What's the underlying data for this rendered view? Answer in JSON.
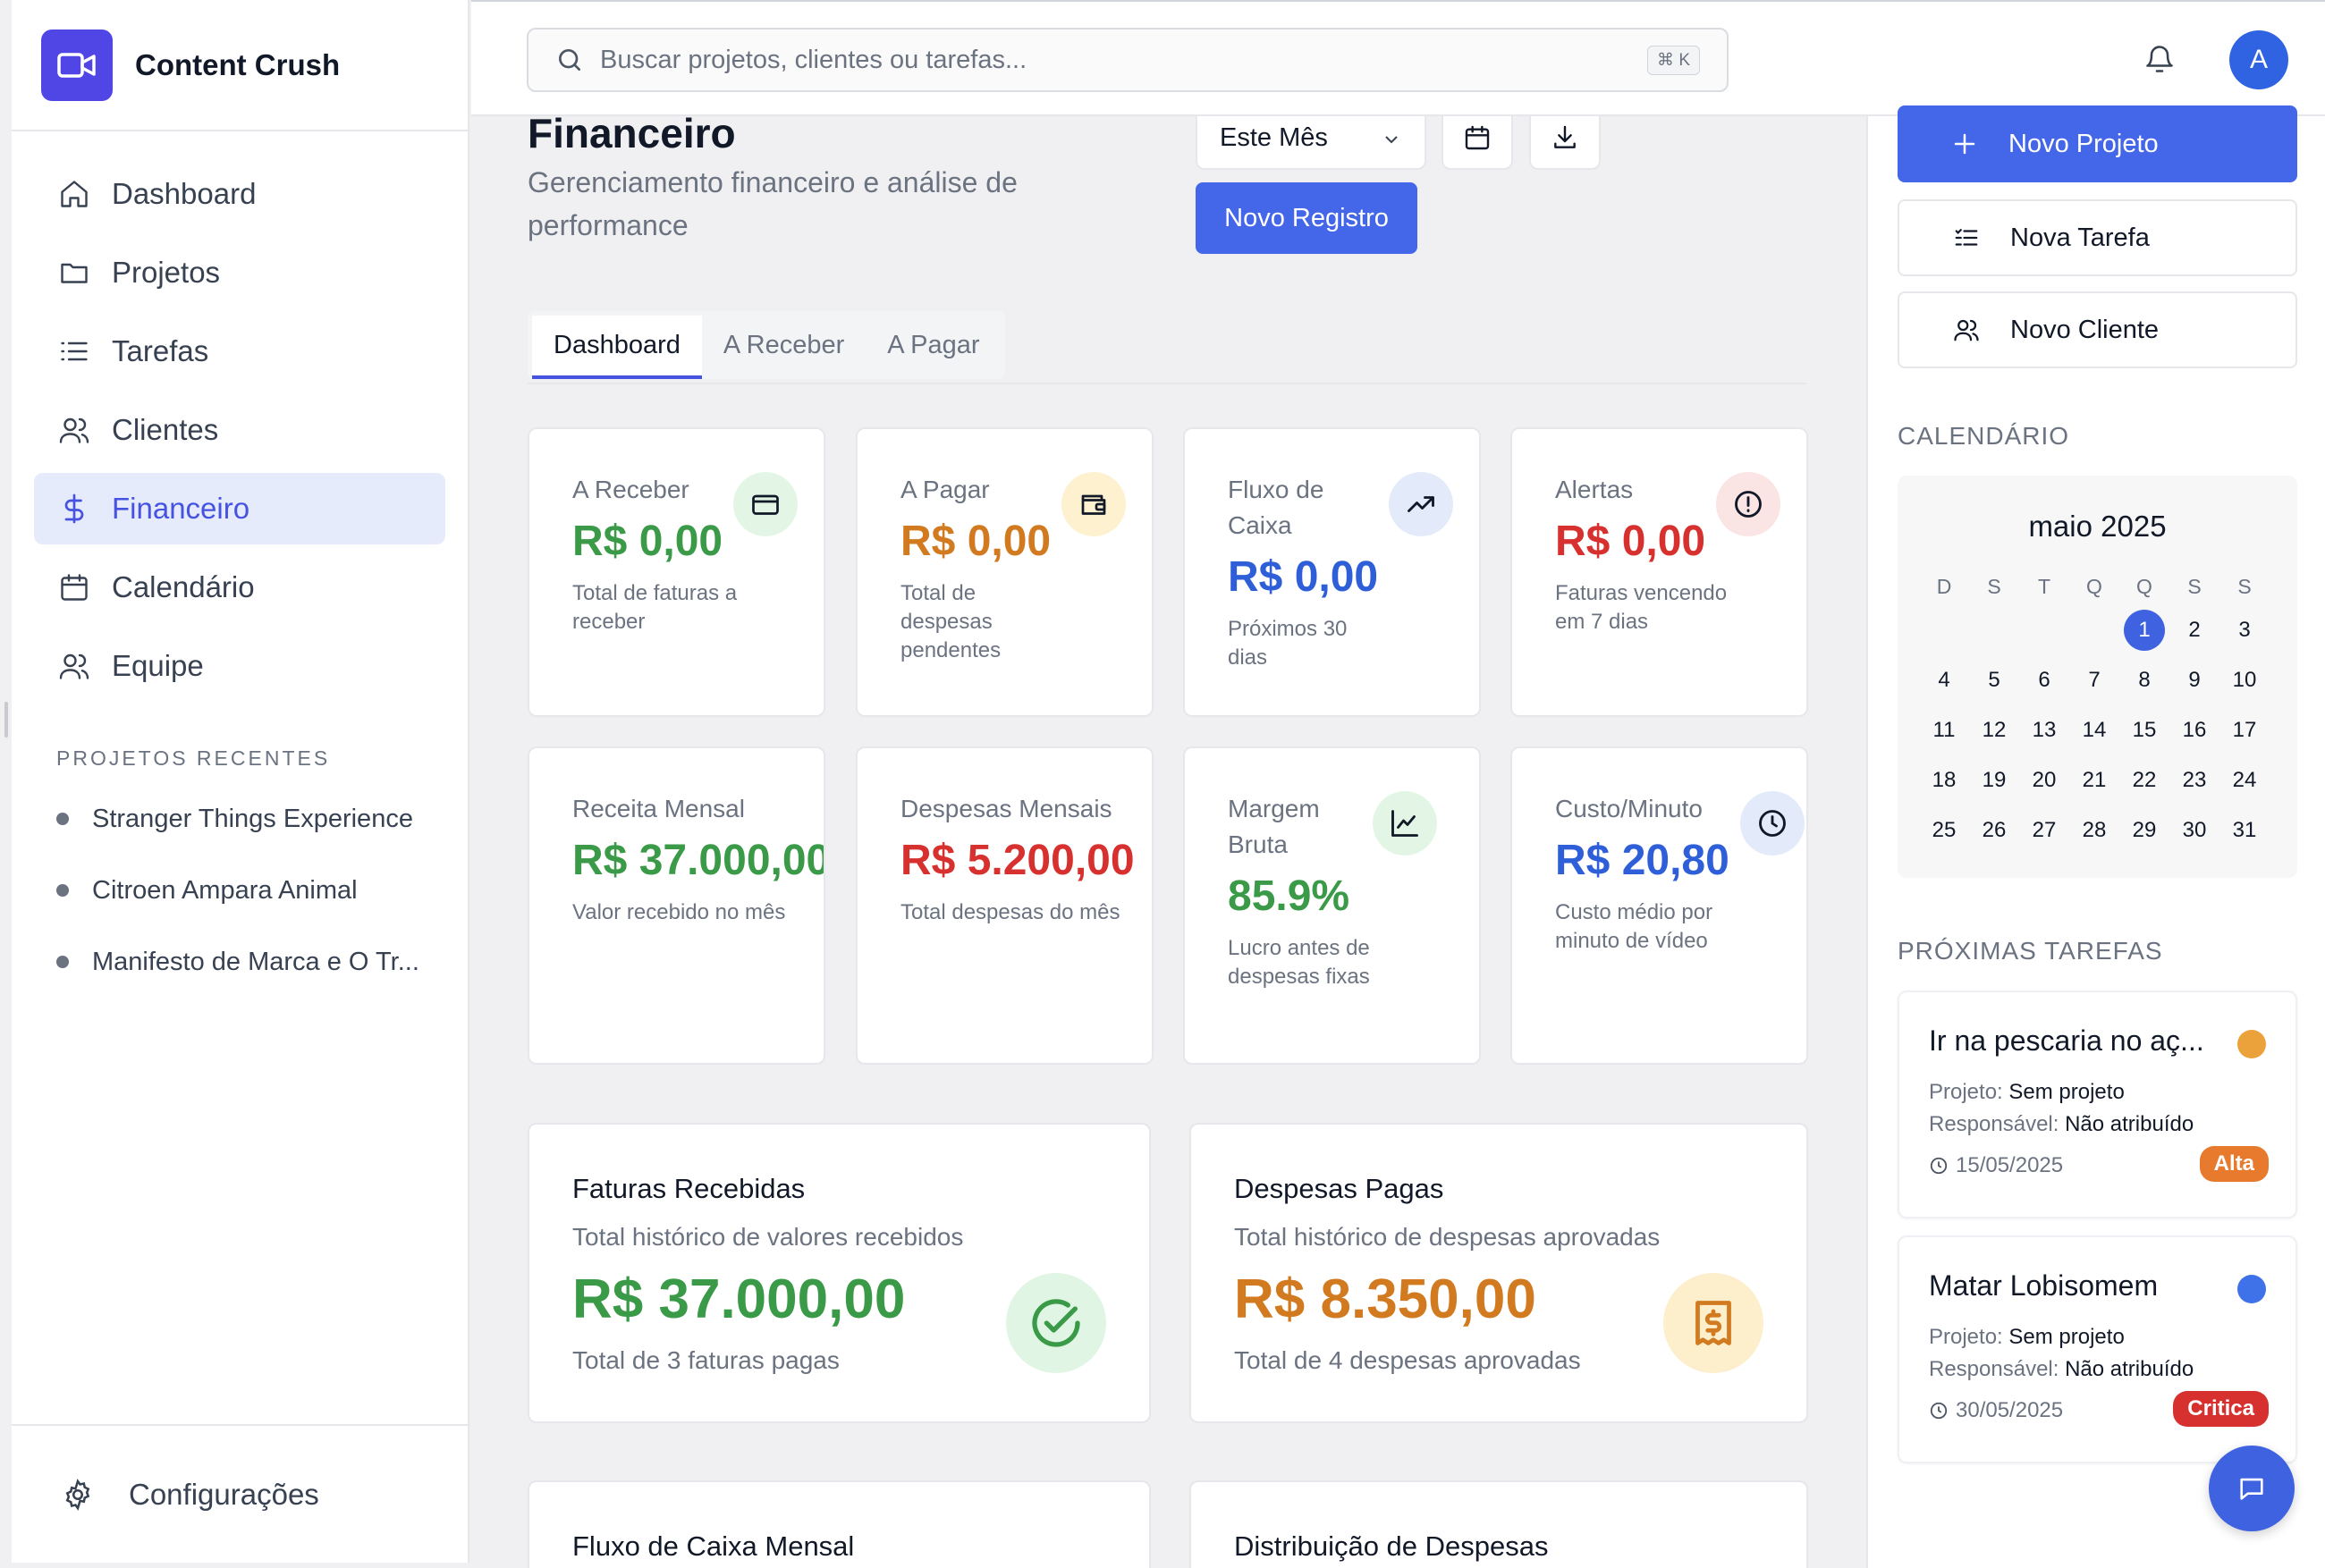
{
  "app": {
    "name": "Content Crush"
  },
  "nav": [
    {
      "label": "Dashboard",
      "icon": "home-icon"
    },
    {
      "label": "Projetos",
      "icon": "folder-icon"
    },
    {
      "label": "Tarefas",
      "icon": "list-icon"
    },
    {
      "label": "Clientes",
      "icon": "users-icon"
    },
    {
      "label": "Financeiro",
      "icon": "dollar-icon",
      "active": true
    },
    {
      "label": "Calendário",
      "icon": "calendar-icon"
    },
    {
      "label": "Equipe",
      "icon": "users-icon"
    }
  ],
  "recent": {
    "label": "PROJETOS RECENTES",
    "items": [
      "Stranger Things Experience",
      "Citroen Ampara Animal",
      "Manifesto de Marca e O Tr..."
    ]
  },
  "settings_label": "Configurações",
  "search": {
    "placeholder": "Buscar projetos, clientes ou tarefas...",
    "shortcut": "⌘ K"
  },
  "user": {
    "initial": "A"
  },
  "page": {
    "title": "Financeiro",
    "subtitle": "Gerenciamento financeiro e análise de performance",
    "period": "Este Mês",
    "new_record": "Novo Registro",
    "tabs": [
      "Dashboard",
      "A Receber",
      "A Pagar"
    ]
  },
  "stats": [
    {
      "title": "A Receber",
      "value": "R$ 0,00",
      "desc": "Total de faturas a receber",
      "color": "#3a9a48",
      "icon": "credit-card-icon"
    },
    {
      "title": "A Pagar",
      "value": "R$ 0,00",
      "desc": "Total de despesas pendentes",
      "color": "#d27a1f",
      "icon": "wallet-icon"
    },
    {
      "title": "Fluxo de Caixa",
      "value": "R$ 0,00",
      "desc": "Próximos 30 dias",
      "color": "#2f5fd8",
      "icon": "trending-up-icon"
    },
    {
      "title": "Alertas",
      "value": "R$ 0,00",
      "desc": "Faturas vencendo em 7 dias",
      "color": "#d7312f",
      "icon": "alert-circle-icon"
    },
    {
      "title": "Receita Mensal",
      "value": "R$ 37.000,00",
      "desc": "Valor recebido no mês",
      "color": "#3a9a48"
    },
    {
      "title": "Despesas Mensais",
      "value": "R$ 5.200,00",
      "desc": "Total despesas do mês",
      "color": "#d7312f"
    },
    {
      "title": "Margem Bruta",
      "value": "85.9%",
      "desc": "Lucro antes de despesas fixas",
      "color": "#3a9a48",
      "icon": "line-chart-icon"
    },
    {
      "title": "Custo/Minuto",
      "value": "R$ 20,80",
      "desc": "Custo médio por minuto de vídeo",
      "color": "#2f5fd8",
      "icon": "clock-icon"
    }
  ],
  "summary": [
    {
      "title": "Faturas Recebidas",
      "sub": "Total histórico de valores recebidos",
      "value": "R$ 37.000,00",
      "desc": "Total de 3 faturas pagas",
      "color": "#3a9a48",
      "icon": "check-circle-icon"
    },
    {
      "title": "Despesas Pagas",
      "sub": "Total histórico de despesas aprovadas",
      "value": "R$ 8.350,00",
      "desc": "Total de 4 despesas aprovadas",
      "color": "#d27a1f",
      "icon": "receipt-icon"
    }
  ],
  "charts_titles": [
    "Fluxo de Caixa Mensal",
    "Distribuição de Despesas"
  ],
  "quick_actions": [
    "Novo Projeto",
    "Nova Tarefa",
    "Novo Cliente"
  ],
  "calendar": {
    "label": "CALENDÁRIO",
    "month": "maio 2025",
    "weekdays": [
      "D",
      "S",
      "T",
      "Q",
      "Q",
      "S",
      "S"
    ],
    "first_weekday": 4,
    "days": 31,
    "today": 1
  },
  "tasks": {
    "label": "PRÓXIMAS TAREFAS",
    "project_key": "Projeto:",
    "owner_key": "Responsável:",
    "items": [
      {
        "title": "Ir na pescaria no aç...",
        "project": "Sem projeto",
        "owner": "Não atribuído",
        "date": "15/05/2025",
        "priority": "Alta",
        "dot": "#eba23a",
        "badge": "#e87a2e"
      },
      {
        "title": "Matar Lobisomem",
        "project": "Sem projeto",
        "owner": "Não atribuído",
        "date": "30/05/2025",
        "priority": "Critica",
        "dot": "#3f72e8",
        "badge": "#d7312f"
      }
    ]
  }
}
